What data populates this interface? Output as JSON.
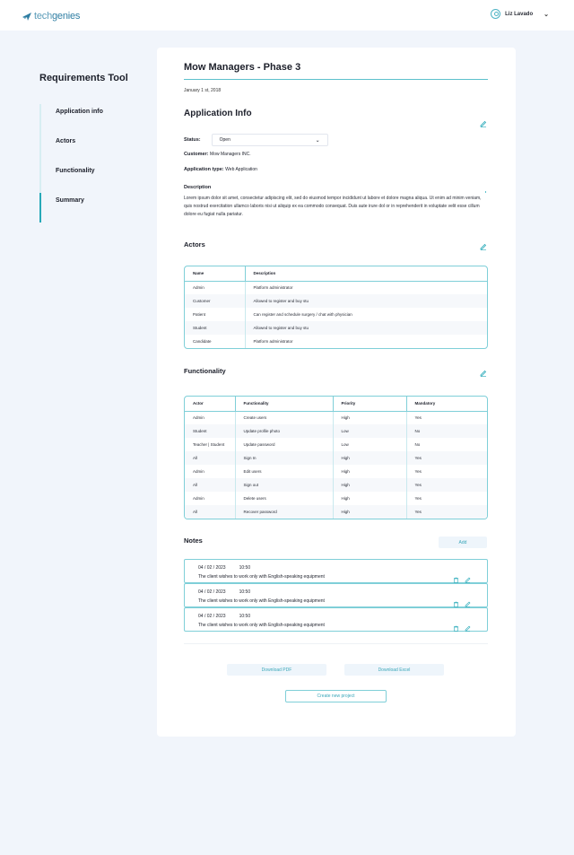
{
  "brand": {
    "logo_prefix": "tech",
    "logo_suffix": "genies",
    "accent": "#27a9b8"
  },
  "user": {
    "name": "Liz Lavado"
  },
  "sidebar": {
    "title": "Requirements Tool",
    "items": [
      {
        "label": "Application info",
        "active": false
      },
      {
        "label": "Actors",
        "active": false
      },
      {
        "label": "Functionality",
        "active": false
      },
      {
        "label": "Summary",
        "active": true
      }
    ]
  },
  "project": {
    "title": "Mow Managers - Phase 3",
    "date": "January 1 st, 2018"
  },
  "app_info": {
    "heading": "Application Info",
    "status_label": "Status:",
    "status_value": "Open",
    "customer_label": "Customer:",
    "customer_value": "Mow Managers INC.",
    "app_type_label": "Application type:",
    "app_type_value": "Web Application",
    "description_label": "Description",
    "description_text": "Lorem ipsum dolor sit amet, consectetur adipiscing elit, sed do eiusmod tempor incididunt ut labore et dolore magna aliqua. Ut enim ad minim veniam, quis nostrud exercitation ullamco laboris nisi ut aliquip ex ea commodo consequat. Duis aute irure dol or in reprehenderit in voluptate velit esse cillum dolore eu fugiat nulla pariatur."
  },
  "actors": {
    "heading": "Actors",
    "columns": [
      "Name",
      "Description"
    ],
    "rows": [
      [
        "Admin",
        "Platform administrator"
      ],
      [
        "Customer",
        "Allowed to register and buy stu"
      ],
      [
        "Patient",
        "Can register and schedule surgery / chat with physician"
      ],
      [
        "Student",
        "Allowed to register and buy stu"
      ],
      [
        "Candidate",
        "Platform administrator"
      ]
    ]
  },
  "functionality": {
    "heading": "Functionality",
    "columns": [
      "Actor",
      "Functionality",
      "Priority",
      "Mandatory"
    ],
    "rows": [
      [
        "Admin",
        "Create users",
        "High",
        "Yes"
      ],
      [
        "Student",
        "Update profile photo",
        "Low",
        "No"
      ],
      [
        "Teacher | Student",
        "Update password",
        "Low",
        "No"
      ],
      [
        "All",
        "Sign In",
        "High",
        "Yes"
      ],
      [
        "Admin",
        "Edit users",
        "High",
        "Yes"
      ],
      [
        "All",
        "Sign out",
        "High",
        "Yes"
      ],
      [
        "Admin",
        "Delete users",
        "High",
        "Yes"
      ],
      [
        "All",
        "Recover password",
        "High",
        "Yes"
      ]
    ]
  },
  "notes": {
    "heading": "Notes",
    "add_label": "Add",
    "items": [
      {
        "date": "04 / 02 / 2023",
        "time": "10:50",
        "text": "The client wishes to work only with English-speaking equipment"
      },
      {
        "date": "04 / 02 / 2023",
        "time": "10:50",
        "text": "The client wishes to work only with English-speaking equipment"
      },
      {
        "date": "04 / 02 / 2023",
        "time": "10:50",
        "text": "The client wishes to work only with English-speaking equipment"
      }
    ]
  },
  "actions": {
    "download_pdf": "Download PDF",
    "download_excel": "Download Excel",
    "create_project": "Create new project"
  }
}
